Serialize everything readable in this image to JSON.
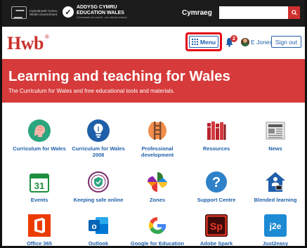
{
  "govbar": {
    "wg_logo_text": [
      "Llywodraeth Cymru",
      "Welsh Government"
    ],
    "ew_logo_text": [
      "ADDYSG CYMRU",
      "EDUCATION WALES"
    ],
    "ew_logo_sub": "Cenhadaeth ein cenedl · our national mission",
    "language_link": "Cymraeg",
    "search": {
      "value": "",
      "placeholder": ""
    }
  },
  "header": {
    "logo": "Hwb",
    "logo_mark": "®",
    "menu_label": "Menu",
    "notification_count": "2",
    "user_name": "E Jones",
    "signout_label": "Sign out"
  },
  "hero": {
    "title": "Learning and teaching for Wales",
    "subtitle": "The Curriculum for Wales and free educational tools and materials."
  },
  "tiles": {
    "row1": [
      {
        "label": "Curriculum for Wales",
        "icon": "brain-icon"
      },
      {
        "label": "Curriculum for Wales 2008",
        "icon": "lightbulb-icon"
      },
      {
        "label": "Professional development",
        "icon": "ladder-icon"
      },
      {
        "label": "Resources",
        "icon": "books-icon"
      },
      {
        "label": "News",
        "icon": "newspaper-icon"
      }
    ],
    "row2": [
      {
        "label": "Events",
        "icon": "calendar-icon",
        "calendar_day": "31"
      },
      {
        "label": "Keeping safe online",
        "icon": "safety-badge-icon"
      },
      {
        "label": "Zones",
        "icon": "pinwheel-icon"
      },
      {
        "label": "Support Centre",
        "icon": "help-icon",
        "glyph": "?"
      },
      {
        "label": "Blended learning",
        "icon": "house-icon"
      }
    ],
    "row3": [
      {
        "label": "Office 365",
        "icon": "office-icon"
      },
      {
        "label": "Outlook",
        "icon": "outlook-icon",
        "glyph": "o"
      },
      {
        "label": "Google for Education",
        "icon": "google-icon",
        "glyph": "G"
      },
      {
        "label": "Adobe Spark",
        "icon": "adobe-spark-icon",
        "glyph": "Sp"
      },
      {
        "label": "Just2easy",
        "icon": "just2easy-icon",
        "glyph": "j2e"
      }
    ]
  },
  "colors": {
    "brand_red": "#d63a3a",
    "link_blue": "#1f5fa9",
    "govbar_bg": "#1b1b1b",
    "highlight": "#e60a14"
  }
}
